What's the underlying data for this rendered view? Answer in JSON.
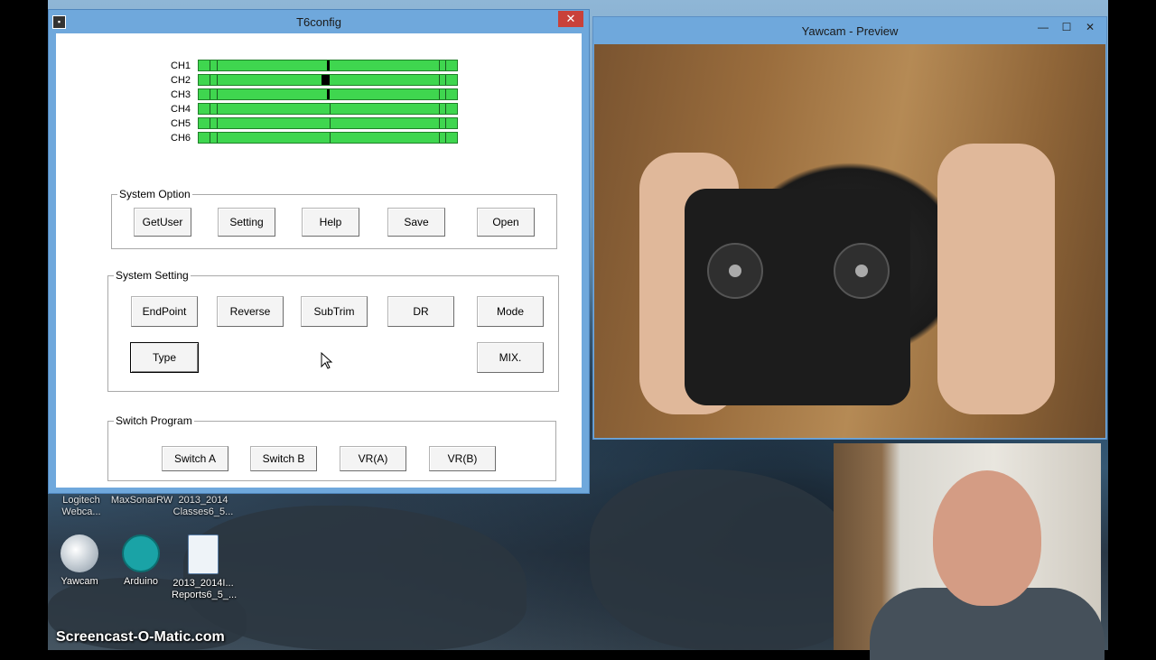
{
  "t6config": {
    "title": "T6config",
    "close_glyph": "✕",
    "channels": [
      {
        "label": "CH1",
        "level": 0.5
      },
      {
        "label": "CH2",
        "level": 0.49
      },
      {
        "label": "CH3",
        "level": 0.5
      },
      {
        "label": "CH4",
        "level": 0.51
      },
      {
        "label": "CH5",
        "level": 0.51
      },
      {
        "label": "CH6",
        "level": 0.51
      }
    ],
    "system_option": {
      "legend": "System Option",
      "buttons": [
        "GetUser",
        "Setting",
        "Help",
        "Save",
        "Open"
      ]
    },
    "system_setting": {
      "legend": "System Setting",
      "row1": [
        "EndPoint",
        "Reverse",
        "SubTrim",
        "DR",
        "Mode"
      ],
      "type_label": "Type",
      "mix_label": "MIX."
    },
    "switch_program": {
      "legend": "Switch Program",
      "buttons": [
        "Switch A",
        "Switch B",
        "VR(A)",
        "VR(B)"
      ]
    }
  },
  "yawcam": {
    "title": "Yawcam - Preview",
    "minimize": "—",
    "maximize": "☐",
    "close": "✕"
  },
  "desktop": {
    "top_icons": [
      {
        "line1": "Logitech",
        "line2": "Webca..."
      },
      {
        "line1": "MaxSonarRW",
        "line2": ""
      },
      {
        "line1": "2013_2014",
        "line2": "Classes6_5..."
      }
    ],
    "icons": [
      {
        "line1": "Yawcam",
        "line2": ""
      },
      {
        "line1": "Arduino",
        "line2": ""
      },
      {
        "line1": "2013_2014I...",
        "line2": "Reports6_5_..."
      }
    ]
  },
  "watermark": "Screencast-O-Matic.com",
  "colors": {
    "window_frame": "#6fa8dc",
    "channel_bar": "#3fd64f",
    "close_button": "#c9413a"
  }
}
